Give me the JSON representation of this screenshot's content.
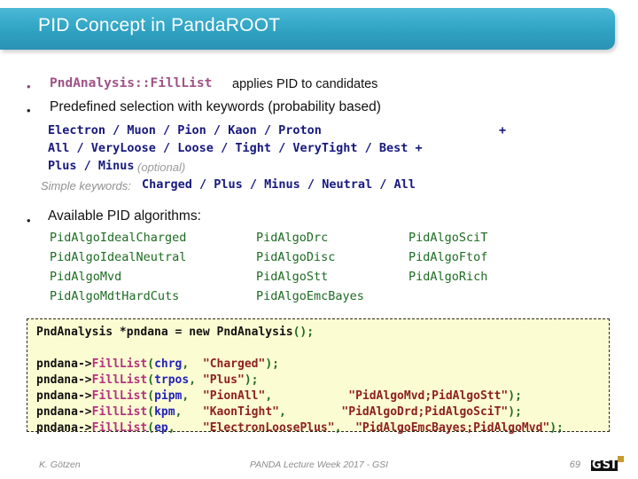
{
  "slide": {
    "title": "PID Concept in PandaROOT",
    "accent_color": "#36a9c8"
  },
  "bullets": {
    "dot": "•",
    "b1": {
      "code": "PndAnalysis::FillList",
      "code_color": "#9e5286",
      "tail": "applies PID to candidates"
    },
    "b2": {
      "text": "Predefined selection with keywords (probability based)",
      "keyword_color": "#17197e",
      "lines": [
        "Electron / Muon / Pion / Kaon / Proton",
        "All / VeryLoose / Loose / Tight / VeryTight / Best +",
        "Plus / Minus",
        "Charged / Plus / Minus / Neutral / All"
      ],
      "plus_line1": "+",
      "optional_label": "(optional)",
      "simple_label": "Simple keywords:"
    },
    "b3": {
      "text": "Available  PID algorithms:",
      "algo_color": "#1d6b22",
      "columns": [
        [
          "PidAlgoIdealCharged",
          "PidAlgoIdealNeutral",
          "PidAlgoMvd",
          "PidAlgoMdtHardCuts"
        ],
        [
          "PidAlgoDrc",
          "PidAlgoDisc",
          "PidAlgoStt",
          "PidAlgoEmcBayes"
        ],
        [
          "PidAlgoSciT",
          "PidAlgoFtof",
          "PidAlgoRich"
        ]
      ]
    }
  },
  "code": {
    "background": "#fcfcd2",
    "l1": {
      "type": "PndAnalysis",
      "ptr": " *pndana = ",
      "new_kw": "new",
      "ctor": " PndAnalysis",
      "paren": "();"
    },
    "l2": {
      "obj": "pndana->",
      "fn": "FillList",
      "open": "(",
      "var": "chrg",
      "sep": ",  ",
      "str": "\"Charged\"",
      "close": ");"
    },
    "l3": {
      "obj": "pndana->",
      "fn": "FillList",
      "open": "(",
      "var": "trpos",
      "sep": ", ",
      "str": "\"Plus\"",
      "close": ");"
    },
    "l4": {
      "obj": "pndana->",
      "fn": "FillList",
      "open": "(",
      "var": "pipm",
      "sep": ",  ",
      "str": "\"PionAll\"",
      "sep2": ",           ",
      "str2": "\"PidAlgoMvd;PidAlgoStt\"",
      "close": ");"
    },
    "l5": {
      "obj": "pndana->",
      "fn": "FillList",
      "open": "(",
      "var": "kpm",
      "sep": ",   ",
      "str": "\"KaonTight\"",
      "sep2": ",        ",
      "str2": "\"PidAlgoDrd;PidAlgoSciT\"",
      "close": ");"
    },
    "l6": {
      "obj": "pndana->",
      "fn": "FillList",
      "open": "(",
      "var": "ep",
      "sep": ",    ",
      "str": "\"ElectronLoosePlus\"",
      "sep2": ",  ",
      "str2": "\"PidAlgoEmcBayes;PidAlgoMvd\"",
      "close": ");"
    }
  },
  "footer": {
    "author": "K. Götzen",
    "center": "PANDA Lecture Week 2017 - GSI",
    "page": "69",
    "logo_text": "GSI",
    "logo_accent": "#c79b2e"
  }
}
